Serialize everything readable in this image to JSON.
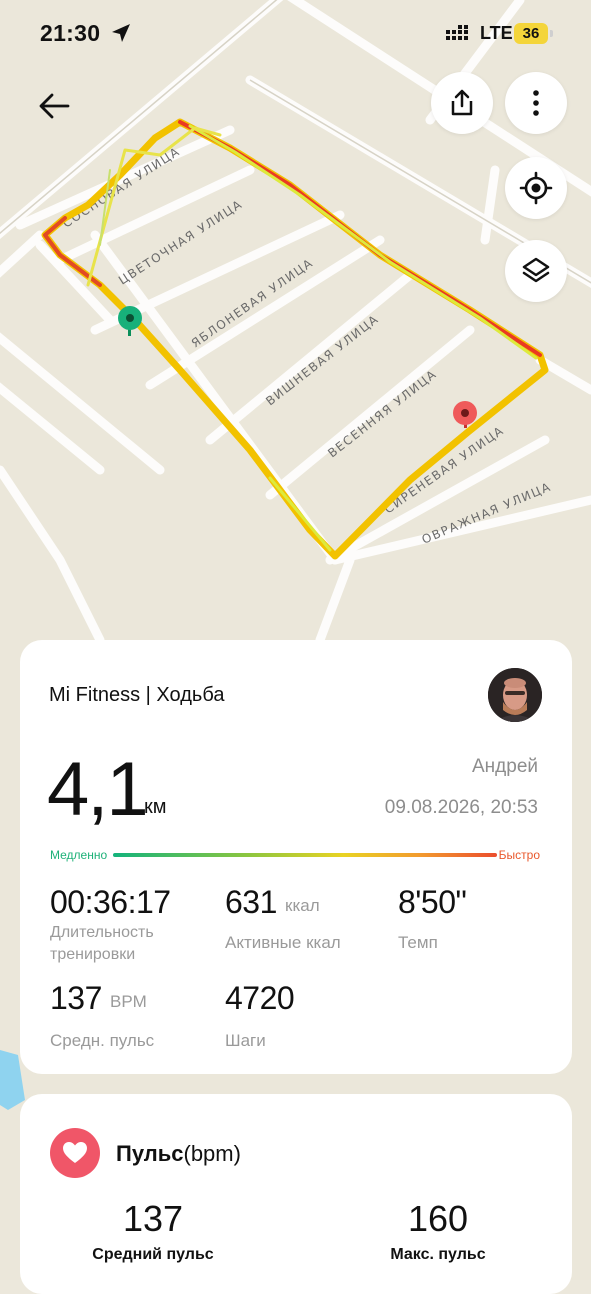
{
  "status_bar": {
    "time": "21:30",
    "network": "LTE",
    "battery": "36"
  },
  "map": {
    "streets": [
      "СОСНОВАЯ УЛИЦА",
      "ЦВЕТОЧНАЯ УЛИЦА",
      "ЯБЛОНЕВАЯ УЛИЦА",
      "ВИШНЕВАЯ УЛИЦА",
      "ВЕСЕННЯЯ УЛИЦА",
      "СИРЕНЕВАЯ УЛИЦА",
      "ОВРАЖНАЯ УЛИЦА"
    ]
  },
  "toolbar": {
    "back_icon": "arrow-left-icon",
    "share_icon": "share-icon",
    "more_icon": "more-vertical-icon",
    "locate_icon": "locate-icon",
    "layers_icon": "layers-icon"
  },
  "workout": {
    "source": "Mi Fitness | Ходьба",
    "distance": "4,1",
    "distance_unit": "км",
    "user": "Андрей",
    "datetime": "09.08.2026, 20:53",
    "pace_scale": {
      "slow": "Медленно",
      "fast": "Быстро"
    },
    "stats": {
      "duration": {
        "value": "00:36:17",
        "label": "Длительность тренировки"
      },
      "calories": {
        "value": "631",
        "unit": "ккал",
        "label": "Активные ккал"
      },
      "pace": {
        "value": "8'50\"",
        "label": "Темп"
      },
      "heart_rate": {
        "value": "137",
        "unit": "BPM",
        "label": "Средн. пульс"
      },
      "steps": {
        "value": "4720",
        "label": "Шаги"
      }
    }
  },
  "pulse": {
    "title": "Пульс",
    "title_unit": "(bpm)",
    "avg": {
      "value": "137",
      "label": "Средний пульс"
    },
    "max": {
      "value": "160",
      "label": "Макс. пульс"
    }
  },
  "colors": {
    "accent_green": "#13b37c",
    "accent_red": "#eb4d2d",
    "heart": "#f05668",
    "battery": "#f4d53a"
  }
}
